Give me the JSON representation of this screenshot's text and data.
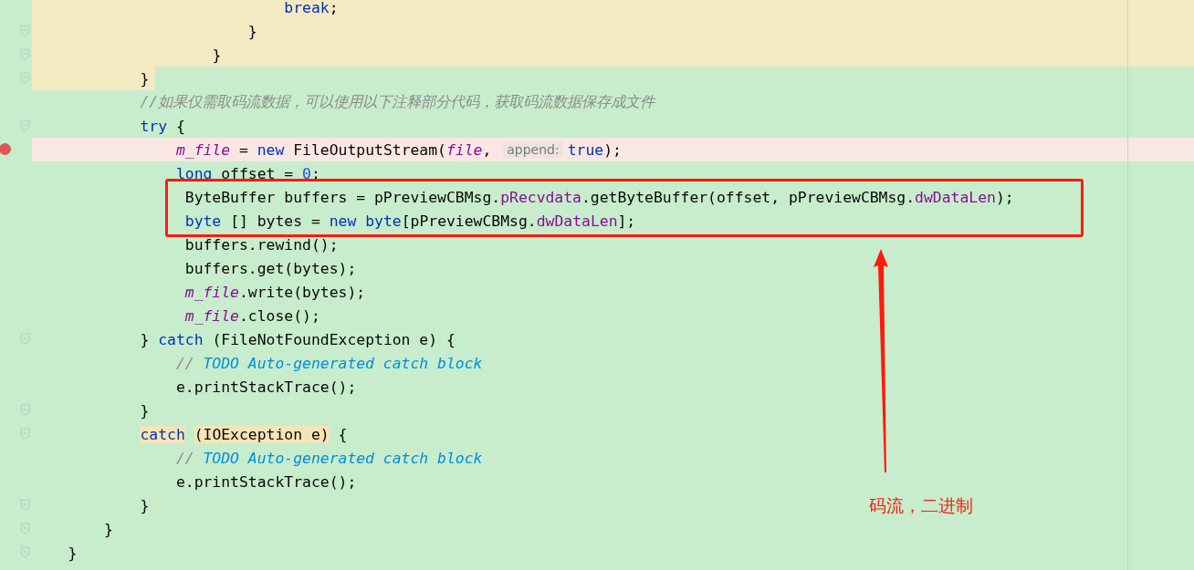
{
  "editor": {
    "lines": [
      {
        "kind": "modified",
        "fold": false,
        "tokens": [
          {
            "text": "                            break",
            "kind": "kw"
          },
          {
            "text": ";",
            "kind": "plain"
          }
        ]
      },
      {
        "kind": "modified",
        "fold": true,
        "tokens": [
          {
            "text": "                        }",
            "kind": "plain"
          }
        ]
      },
      {
        "kind": "modified",
        "fold": true,
        "tokens": [
          {
            "text": "                    }",
            "kind": "plain"
          }
        ]
      },
      {
        "kind": "modified_partial",
        "fold": true,
        "tokens": [
          {
            "text": "            }",
            "kind": "plain"
          }
        ]
      },
      {
        "kind": "plain",
        "fold": false,
        "tokens": [
          {
            "text": "            //如果仅需取码流数据，可以使用以下注释部分代码，获取码流数据保存成文件",
            "kind": "comment"
          }
        ]
      },
      {
        "kind": "plain",
        "fold": true,
        "tokens": [
          {
            "text": "            try",
            "kind": "kw"
          },
          {
            "text": " {",
            "kind": "plain"
          }
        ]
      },
      {
        "kind": "breakpoint",
        "fold": false,
        "tokens": [
          {
            "text": "                m_file",
            "kind": "field_italic"
          },
          {
            "text": " = ",
            "kind": "plain"
          },
          {
            "text": "new",
            "kind": "kw"
          },
          {
            "text": " FileOutputStream(",
            "kind": "plain"
          },
          {
            "text": "file",
            "kind": "field_italic"
          },
          {
            "text": ", ",
            "kind": "plain"
          },
          {
            "text": "append:",
            "kind": "hint"
          },
          {
            "text": "true",
            "kind": "kw"
          },
          {
            "text": ");",
            "kind": "plain"
          }
        ]
      },
      {
        "kind": "plain",
        "fold": false,
        "tokens": [
          {
            "text": "                long",
            "kind": "kw"
          },
          {
            "text": " offset = ",
            "kind": "plain"
          },
          {
            "text": "0",
            "kind": "num"
          },
          {
            "text": ";",
            "kind": "plain"
          }
        ]
      },
      {
        "kind": "plain",
        "fold": false,
        "tokens": [
          {
            "text": "                 ByteBuffer buffers = pPreviewCBMsg.",
            "kind": "plain"
          },
          {
            "text": "pRecvdata",
            "kind": "field"
          },
          {
            "text": ".getByteBuffer(offset, pPreviewCBMsg.",
            "kind": "plain"
          },
          {
            "text": "dwDataLen",
            "kind": "field"
          },
          {
            "text": ");",
            "kind": "plain"
          }
        ]
      },
      {
        "kind": "plain",
        "fold": false,
        "tokens": [
          {
            "text": "                 byte",
            "kind": "kw"
          },
          {
            "text": " [] bytes = ",
            "kind": "plain"
          },
          {
            "text": "new",
            "kind": "kw"
          },
          {
            "text": " byte",
            "kind": "kw"
          },
          {
            "text": "[pPreviewCBMsg.",
            "kind": "plain"
          },
          {
            "text": "dwDataLen",
            "kind": "field"
          },
          {
            "text": "];",
            "kind": "plain"
          }
        ]
      },
      {
        "kind": "plain",
        "fold": false,
        "tokens": [
          {
            "text": "                 buffers.rewind();",
            "kind": "plain"
          }
        ]
      },
      {
        "kind": "plain",
        "fold": false,
        "tokens": [
          {
            "text": "                 buffers.get(bytes);",
            "kind": "plain"
          }
        ]
      },
      {
        "kind": "plain",
        "fold": false,
        "tokens": [
          {
            "text": "                 m_file",
            "kind": "field_italic"
          },
          {
            "text": ".write(bytes);",
            "kind": "plain"
          }
        ]
      },
      {
        "kind": "plain",
        "fold": false,
        "tokens": [
          {
            "text": "                 m_file",
            "kind": "field_italic"
          },
          {
            "text": ".close();",
            "kind": "plain"
          }
        ]
      },
      {
        "kind": "plain",
        "fold": true,
        "tokens": [
          {
            "text": "            } ",
            "kind": "plain"
          },
          {
            "text": "catch",
            "kind": "kw"
          },
          {
            "text": " (FileNotFoundException e) {",
            "kind": "plain"
          }
        ]
      },
      {
        "kind": "plain",
        "fold": false,
        "tokens": [
          {
            "text": "                // ",
            "kind": "comment"
          },
          {
            "text": "TODO Auto-generated catch block",
            "kind": "todo"
          }
        ]
      },
      {
        "kind": "plain",
        "fold": false,
        "tokens": [
          {
            "text": "                e.printStackTrace();",
            "kind": "plain"
          }
        ]
      },
      {
        "kind": "plain",
        "fold": true,
        "tokens": [
          {
            "text": "            }",
            "kind": "plain"
          }
        ]
      },
      {
        "kind": "plain",
        "fold": true,
        "tokens": [
          {
            "text": "            catch",
            "kind": "kw_match"
          },
          {
            "text": " (IOException e)",
            "kind": "match"
          },
          {
            "text": " {",
            "kind": "plain"
          }
        ]
      },
      {
        "kind": "plain",
        "fold": false,
        "tokens": [
          {
            "text": "                // ",
            "kind": "comment"
          },
          {
            "text": "TODO Auto-generated catch block",
            "kind": "todo"
          }
        ]
      },
      {
        "kind": "plain",
        "fold": false,
        "tokens": [
          {
            "text": "                e.printStackTrace();",
            "kind": "plain"
          }
        ]
      },
      {
        "kind": "plain",
        "fold": true,
        "tokens": [
          {
            "text": "            }",
            "kind": "plain"
          }
        ]
      },
      {
        "kind": "plain",
        "fold": true,
        "tokens": [
          {
            "text": "        }",
            "kind": "plain"
          }
        ]
      },
      {
        "kind": "plain",
        "fold": true,
        "tokens": [
          {
            "text": "    }",
            "kind": "plain"
          }
        ]
      }
    ]
  },
  "annotation": {
    "label": "码流，二进制"
  }
}
